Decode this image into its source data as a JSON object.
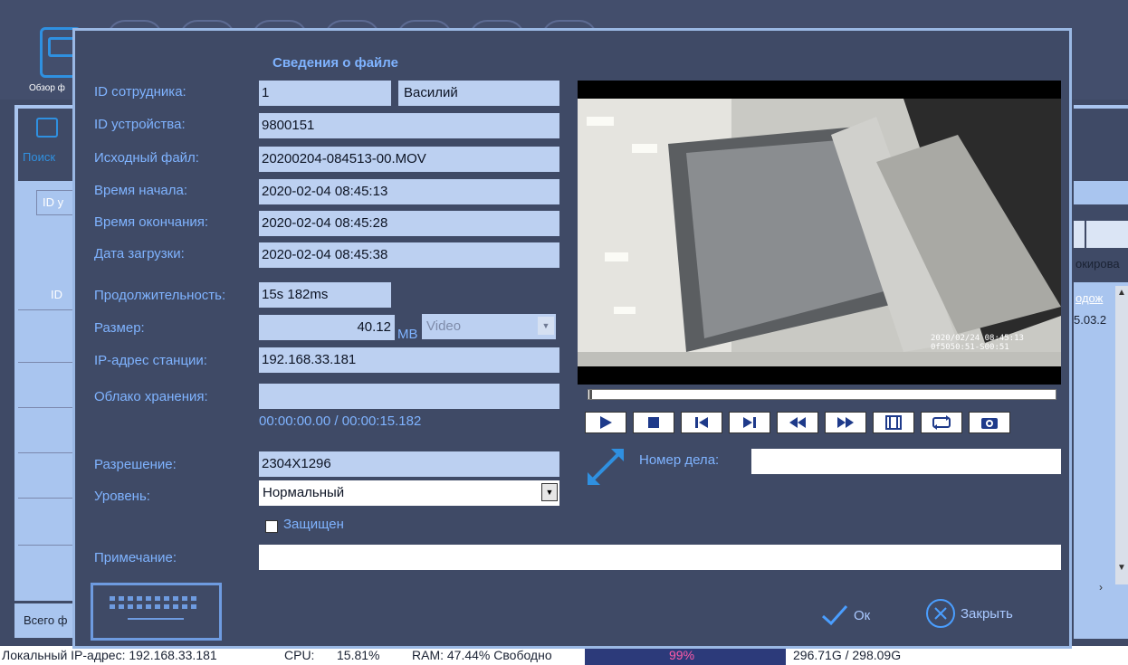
{
  "background": {
    "browse_label": "Обзор ф",
    "search_label": "Поиск",
    "id_box": "ID у",
    "id_column": "ID",
    "total_label": "Всего ф",
    "right_blocked_label": "окирова",
    "right_duration_label": "одож",
    "right_date_cell": "5.03.2"
  },
  "dialog": {
    "title": "Сведения о файле",
    "labels": {
      "employee_id": "ID сотрудника:",
      "device_id": "ID устройства:",
      "source_file": "Исходный файл:",
      "start_time": "Время начала:",
      "end_time": "Время окончания:",
      "upload_date": "Дата загрузки:",
      "duration": "Продолжительность:",
      "size": "Размер:",
      "station_ip": "IP-адрес станции:",
      "cloud_storage": "Облако хранения:",
      "resolution": "Разрешение:",
      "level": "Уровень:",
      "protected": "Защищен",
      "note": "Примечание:",
      "case_number": "Номер дела:"
    },
    "values": {
      "employee_id": "1",
      "employee_name": "Василий",
      "device_id": "9800151",
      "source_file": "20200204-084513-00.MOV",
      "start_time": "2020-02-04 08:45:13",
      "end_time": "2020-02-04 08:45:28",
      "upload_date": "2020-02-04 08:45:38",
      "duration": "15s 182ms",
      "size": "40.12",
      "size_unit": "MB",
      "file_type": "Video",
      "station_ip": "192.168.33.181",
      "cloud_storage": "",
      "time_counter": "00:00:00.00 / 00:00:15.182",
      "resolution": "2304X1296",
      "level": "Нормальный",
      "protected": false,
      "note": "",
      "case_number": ""
    },
    "video_stamp": "2020/02/04 08:45:13\n0f5050:51-S00:51",
    "buttons": {
      "ok": "Ок",
      "close": "Закрыть"
    },
    "player_controls": [
      "play",
      "stop",
      "prev-frame",
      "next-frame",
      "rewind",
      "fast-forward",
      "clip",
      "loop",
      "snapshot"
    ]
  },
  "status_bar": {
    "local_ip": "Локальный IP-адрес: 192.168.33.181",
    "cpu_label": "CPU:",
    "cpu_value": "15.81%",
    "ram": "RAM: 47.44% Свободно",
    "disk_percent": "99%",
    "disk": "296.71G / 298.09G"
  },
  "colors": {
    "dialog_bg": "#3f4a66",
    "label": "#7fb3ff",
    "field": "#bcd0f1",
    "accent": "#2f90e0"
  }
}
